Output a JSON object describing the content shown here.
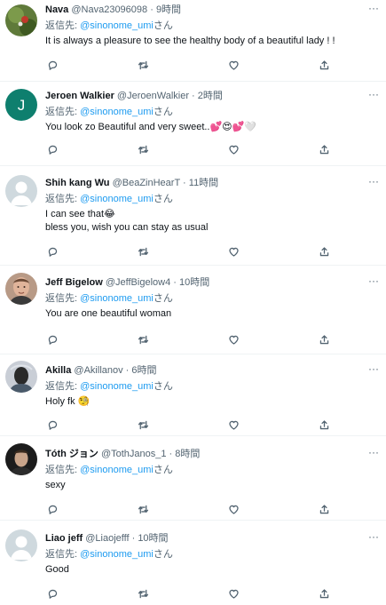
{
  "reply_prefix": "返信先: ",
  "reply_suffix": "さん",
  "more_glyph": "···",
  "separator": " · ",
  "tweets": [
    {
      "name": "Nava",
      "handle": "@Nava23096098",
      "time": "9時間",
      "reply_to": "@sinonome_umi",
      "lines": [
        "It is always a pleasure to see the healthy body of a beautiful lady ! !"
      ],
      "avatar": {
        "type": "photo",
        "bg": "#5f7a3a",
        "accent": "#c0392b"
      }
    },
    {
      "name": "Jeroen Walkier",
      "handle": "@JeroenWalkier",
      "time": "2時間",
      "reply_to": "@sinonome_umi",
      "lines": [
        "You look zo Beautiful and very sweet..💕😍💕🤍"
      ],
      "avatar": {
        "type": "letter",
        "letter": "J",
        "bg": "#0e7f6e"
      }
    },
    {
      "name": "Shih kang Wu",
      "handle": "@BeaZinHearT",
      "time": "11時間",
      "reply_to": "@sinonome_umi",
      "lines": [
        "I can see that😂",
        "bless you, wish you can stay as usual"
      ],
      "avatar": {
        "type": "default",
        "bg": "#cfd9de",
        "fg": "#ffffff"
      }
    },
    {
      "name": "Jeff Bigelow",
      "handle": "@JeffBigelow4",
      "time": "10時間",
      "reply_to": "@sinonome_umi",
      "lines": [
        "You are one beautiful woman"
      ],
      "avatar": {
        "type": "face",
        "bg": "#b89a86",
        "skin": "#e0b49a"
      }
    },
    {
      "name": "Akilla",
      "handle": "@Akillanov",
      "time": "6時間",
      "reply_to": "@sinonome_umi",
      "lines": [
        "Holy fk 🧐"
      ],
      "avatar": {
        "type": "face",
        "bg": "#c9ced6",
        "skin": "#2a2a2a"
      }
    },
    {
      "name": "Tóth ジョン",
      "handle": "@TothJanos_1",
      "time": "8時間",
      "reply_to": "@sinonome_umi",
      "lines": [
        "sexy"
      ],
      "avatar": {
        "type": "face",
        "bg": "#1c1c1c",
        "skin": "#c9a48a"
      }
    },
    {
      "name": "Liao jeff",
      "handle": "@Liaojefff",
      "time": "10時間",
      "reply_to": "@sinonome_umi",
      "lines": [
        "Good"
      ],
      "avatar": {
        "type": "default",
        "bg": "#cfd9de",
        "fg": "#ffffff"
      }
    }
  ],
  "action_icons": [
    "reply-icon",
    "retweet-icon",
    "like-icon",
    "share-icon"
  ]
}
